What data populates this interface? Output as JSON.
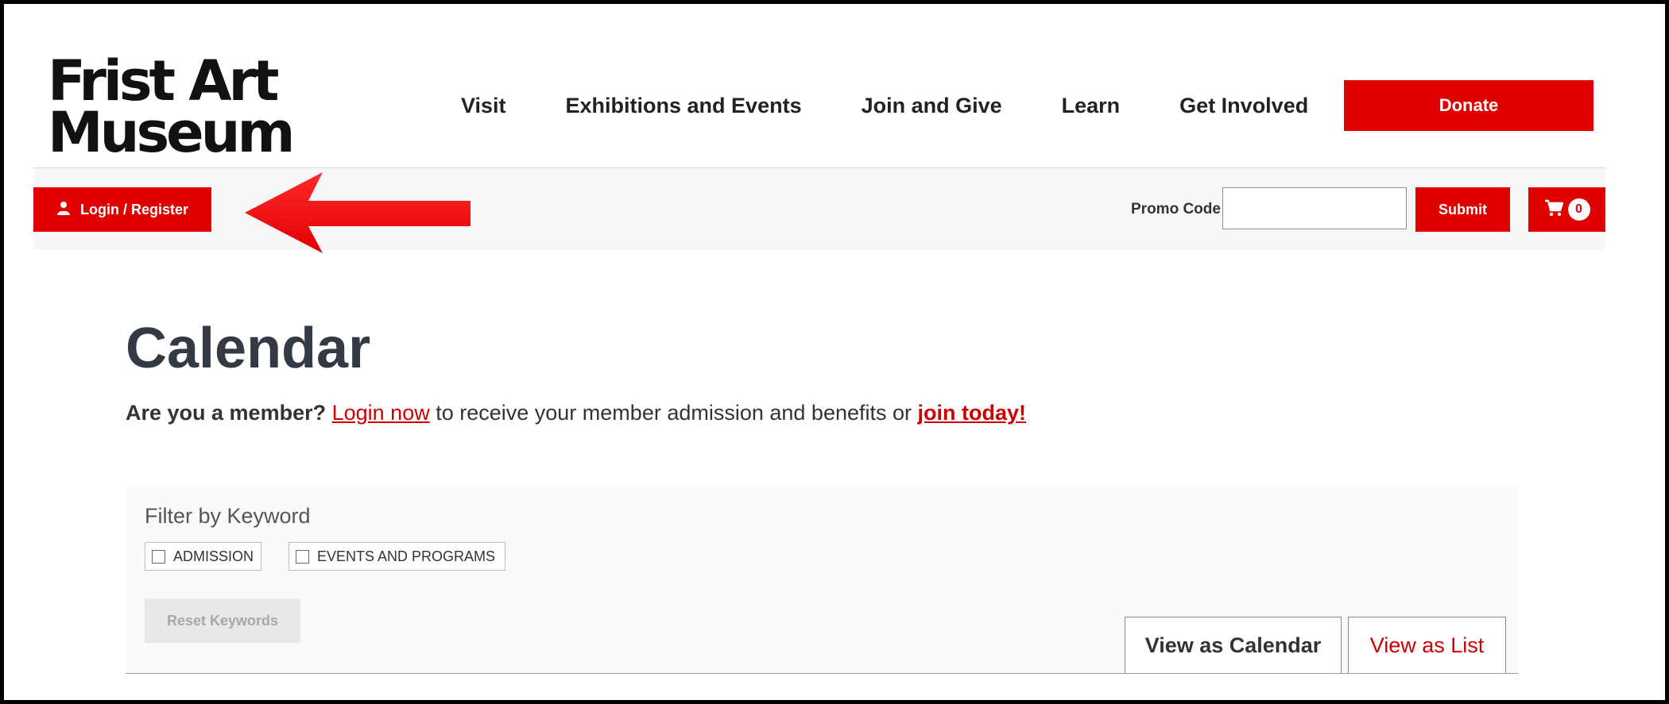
{
  "header": {
    "logo_line1": "Frist Art",
    "logo_line2": "Museum",
    "nav": [
      "Visit",
      "Exhibitions and Events",
      "Join and Give",
      "Learn",
      "Get Involved"
    ],
    "donate_label": "Donate"
  },
  "toolbar": {
    "login_label": "Login / Register",
    "promo_label": "Promo Code",
    "promo_value": "",
    "submit_label": "Submit",
    "cart_count": "0"
  },
  "main": {
    "title": "Calendar",
    "member_question": "Are you a member?",
    "login_link": "Login now",
    "member_middle": " to receive your member admission and benefits or ",
    "join_link": "join today!"
  },
  "filter": {
    "title": "Filter by Keyword",
    "keywords": [
      "ADMISSION",
      "EVENTS AND PROGRAMS"
    ],
    "reset_label": "Reset Keywords",
    "tab_calendar": "View as Calendar",
    "tab_list": "View as List"
  },
  "colors": {
    "brand_red": "#e00000",
    "text_dark": "#333a44"
  },
  "icons": {
    "user": "user-icon",
    "cart": "cart-icon",
    "annotation_arrow": "arrow-left-icon"
  }
}
